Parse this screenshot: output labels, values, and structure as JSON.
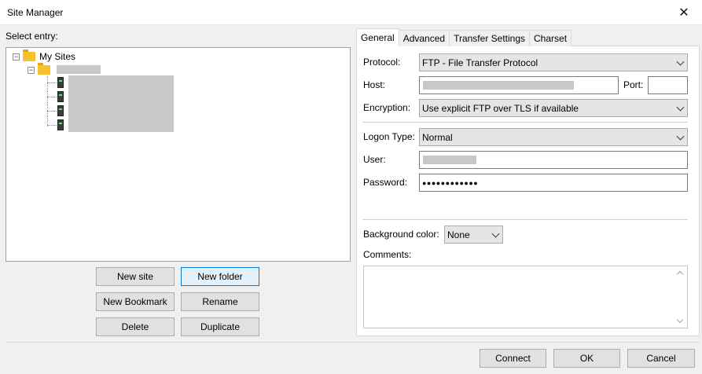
{
  "window": {
    "title": "Site Manager"
  },
  "left": {
    "select_label": "Select entry:",
    "tree": {
      "root": "My Sites"
    },
    "buttons": {
      "new_site": "New site",
      "new_folder": "New folder",
      "new_bookmark": "New Bookmark",
      "rename": "Rename",
      "delete": "Delete",
      "duplicate": "Duplicate"
    }
  },
  "tabs": [
    "General",
    "Advanced",
    "Transfer Settings",
    "Charset"
  ],
  "general": {
    "protocol_label": "Protocol:",
    "protocol_value": "FTP - File Transfer Protocol",
    "host_label": "Host:",
    "port_label": "Port:",
    "port_value": "",
    "encryption_label": "Encryption:",
    "encryption_value": "Use explicit FTP over TLS if available",
    "logon_label": "Logon Type:",
    "logon_value": "Normal",
    "user_label": "User:",
    "password_label": "Password:",
    "password_value": "●●●●●●●●●●●●",
    "bgcolor_label": "Background color:",
    "bgcolor_value": "None",
    "comments_label": "Comments:"
  },
  "footer": {
    "connect": "Connect",
    "ok": "OK",
    "cancel": "Cancel"
  }
}
